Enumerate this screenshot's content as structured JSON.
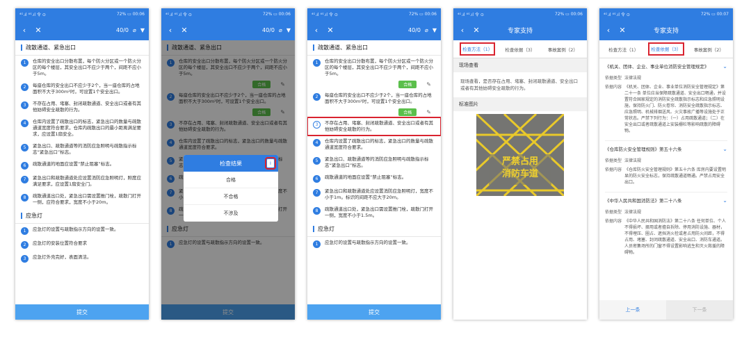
{
  "status_bar": {
    "left": "⁴ᴳ.ıl ⁴ᴳ.ıl 令 ⊙",
    "right": "72% ▭ 00:06",
    "right_p5": "72% ▭ 00:07"
  },
  "checklist_screen": {
    "counter": "40/0",
    "section1_title": "疏散通道、紧急出口",
    "items": [
      "仓库的安全出口分散布置，每个防火分区或一个防火分区的每个楼层，其安全出口不应少于两个，间距不应小于5m。",
      "每座仓库的安全出口不应少于2个，当一座仓库的占地面积不大于300m²时，可设置1个安全出口。",
      "不存在占用、堵塞、封闭疏散通道、安全出口或者有其他妨碍安全疏散的行为。",
      "仓库内设置了疏散出口的标志，紧急出口的数量与疏散通道宽度符合要求，仓库内疏散出口的最小距离满足要求，应设置1扇安全。",
      "紧急出口、疏散通道等的消防应急照明与疏散指示标志“紧急出口”标志。",
      "疏散通道的地面应设置“禁止阻塞”标志。",
      "紧急出口和疏散通道处应设置消防应急照明灯，照度应满足要求，应设置1扇安全门。",
      "疏散通道出口处，紧急出口需设置推门栓，疏散门打开一侧，应符合要求，宽度不小于20m。"
    ],
    "visible_items_p2": [
      "仓库的安全出口分散布置，每个防火分区或一个防火分区的每个楼层，其安全出口不应少于两个，间距不应小于5m。",
      "每座仓库的安全出口不应少于2个，当一座仓库的占地面积不大于300m²时，可设置1个安全出口。",
      "不存在占用、堵塞、封闭疏散通道、安全出口或者有其他妨碍安全疏散的行为。",
      "仓库内设置了疏散出口的标志，紧急出口的数量与疏散通道宽度符合要求。",
      "紧急出口、疏散通道等的消防应急照明与疏散指示标志“紧急出口”标志。",
      "疏散通道的地面应设置“禁止阻塞”标志。",
      "紧急出口和疏散通道处应设置消防应急照明灯，宽度不小于1m。标识的间距不应大于20m。",
      "疏散通道出口处，紧急出口需设置推门栓，疏散门打开一侧，宽度不小于1.5m。"
    ],
    "section2_title": "应急灯",
    "lamp_items": [
      "应急灯的设置与疏散指示方向的设置一致。",
      "应急灯的安装位置符合要求",
      "应急灯外壳完好，表面清洁。"
    ],
    "ok_label": "合格",
    "submit_label": "提交"
  },
  "dialog": {
    "title": "检查结果",
    "doc_icon_label": "i",
    "options": [
      "合格",
      "不合格",
      "不涉及"
    ]
  },
  "expert_screen": {
    "title": "专家支持",
    "tabs": [
      "检查方法（1）",
      "检查依据（3）",
      "事故案例（2）"
    ],
    "method_heading": "现场查看",
    "method_text": "现场查看，是否存在占用、堵塞、封闭疏散通道、安全出口或者有其他妨碍安全疏散的行为。",
    "picture_heading": "标准图片",
    "sign_line1": "严禁占用",
    "sign_line2": "消防车道"
  },
  "basis_screen": {
    "title": "专家支持",
    "tabs": [
      "检查方法（1）",
      "检查依据（3）",
      "事故案例（2）"
    ],
    "laws": [
      {
        "name": "《机关、团体、企业、事业单位消防安全管理规定》",
        "type_label": "依据类型",
        "type": "法律法规",
        "content_label": "依据内容",
        "content": "《机关、团体、企业、事业单位消防安全管理规定》第二十一条 单位应当保障疏散通道、安全出口畅通，并设置符合国家规定的消防安全疏散指示标志和应急照明设施，保持防火门、防火卷帘、消防安全疏散指示标志、应急照明、机械排烟送风、火灾事故广播等设施处于正常状态。严禁下列行为：（一）占用疏散通道；（二）在安全出口或者疏散通道上安装栅栏等影响疏散的障碍物。"
      },
      {
        "name": "《仓库防火安全管理规则》第五十六条",
        "type_label": "依据类型",
        "type": "法律法规",
        "content_label": "依据内容",
        "content": "《仓库防火安全管理规则》第五十六条 库房内要设置明显的防火安全标志，保持疏散通道畅通。严禁占用安全出口。"
      },
      {
        "name": "《中华人民共和国消防法》第二十八条",
        "type_label": "依据类型",
        "type": "法律法规",
        "content_label": "依据内容",
        "content": "《中华人民共和国消防法》第二十八条 任何单位、个人不得损坏、挪用或者擅自拆除、停用消防设施、器材，不得埋压、圈占、遮挡消火栓或者占用防火间距，不得占用、堵塞、封闭疏散通道、安全出口、消防车通道。人员密集场所的门窗不得设置影响逃生和灭火救援的障碍物。"
      }
    ],
    "prev_label": "上一条",
    "next_label": "下一条"
  },
  "colors": {
    "brand": "#2f7de1",
    "highlight": "#d9232f",
    "ok": "#5bbf4b",
    "submit": "#4da3f0"
  }
}
